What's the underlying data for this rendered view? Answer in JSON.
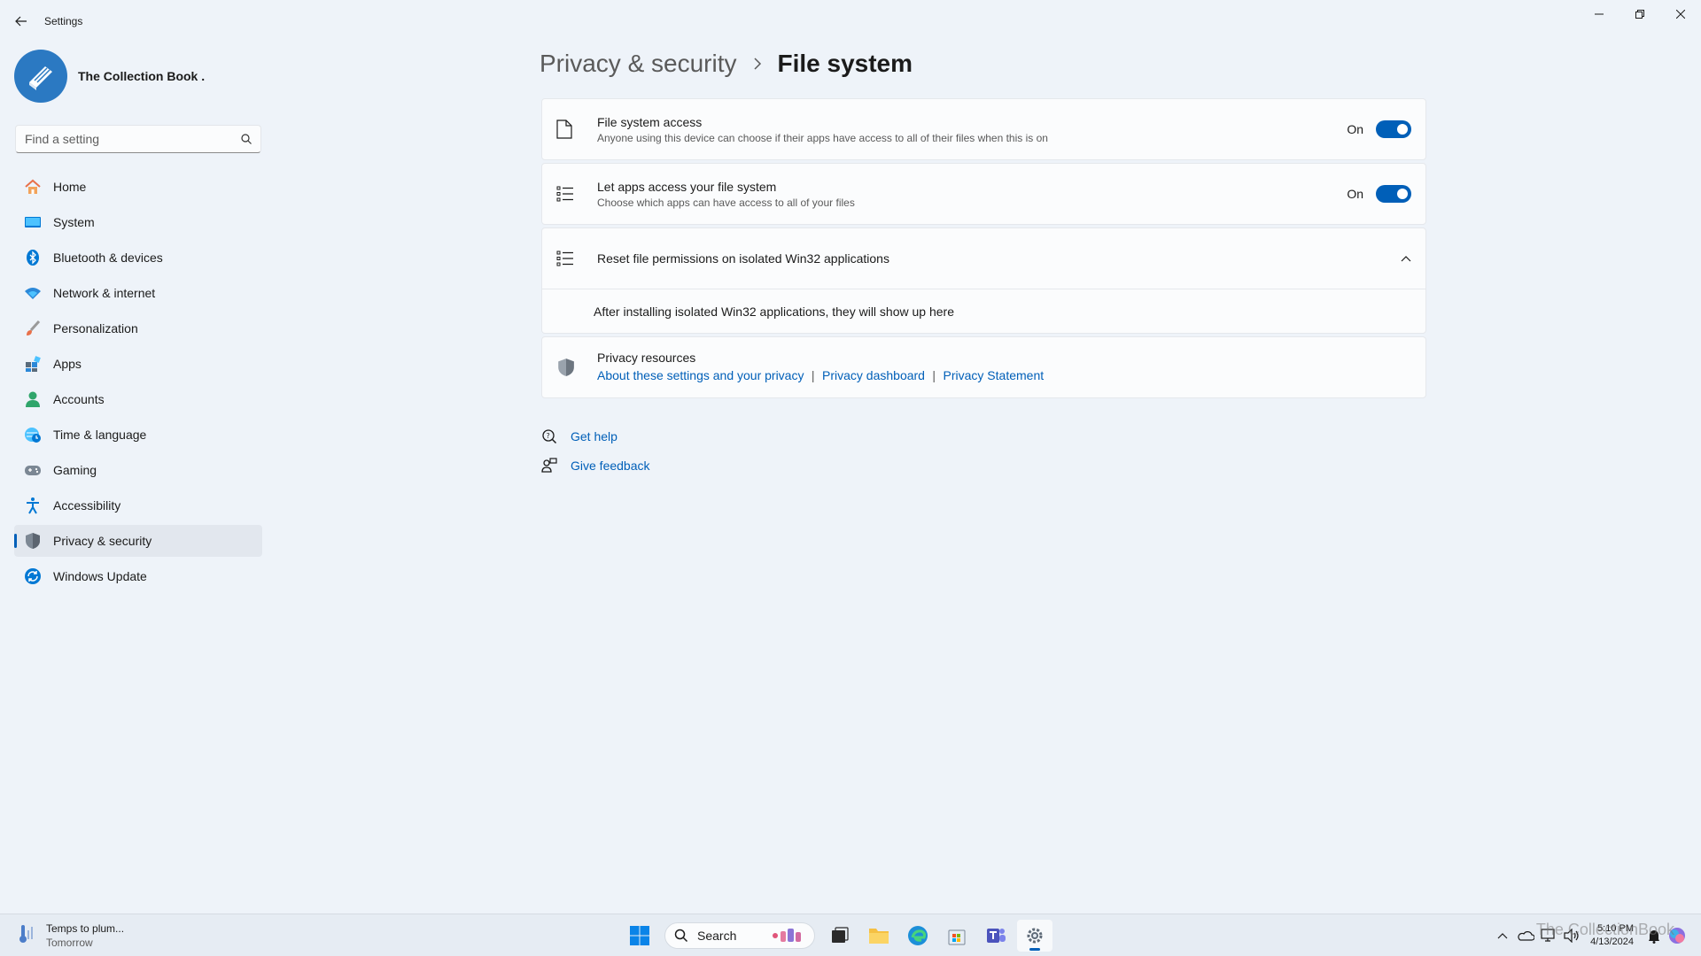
{
  "app": {
    "title": "Settings"
  },
  "profile": {
    "name": "The Collection Book ."
  },
  "search": {
    "placeholder": "Find a setting"
  },
  "sidebar": {
    "items": [
      {
        "label": "Home",
        "icon": "home-icon"
      },
      {
        "label": "System",
        "icon": "system-icon"
      },
      {
        "label": "Bluetooth & devices",
        "icon": "bluetooth-icon"
      },
      {
        "label": "Network & internet",
        "icon": "wifi-icon"
      },
      {
        "label": "Personalization",
        "icon": "brush-icon"
      },
      {
        "label": "Apps",
        "icon": "apps-icon"
      },
      {
        "label": "Accounts",
        "icon": "account-icon"
      },
      {
        "label": "Time & language",
        "icon": "globe-clock-icon"
      },
      {
        "label": "Gaming",
        "icon": "gamepad-icon"
      },
      {
        "label": "Accessibility",
        "icon": "accessibility-icon"
      },
      {
        "label": "Privacy & security",
        "icon": "shield-icon",
        "active": true
      },
      {
        "label": "Windows Update",
        "icon": "update-icon"
      }
    ]
  },
  "breadcrumb": {
    "parent": "Privacy & security",
    "current": "File system"
  },
  "settings": {
    "file_access": {
      "title": "File system access",
      "desc": "Anyone using this device can choose if their apps have access to all of their files when this is on",
      "state": "On"
    },
    "apps_access": {
      "title": "Let apps access your file system",
      "desc": "Choose which apps can have access to all of your files",
      "state": "On"
    },
    "reset": {
      "title": "Reset file permissions on isolated Win32 applications",
      "body": "After installing isolated Win32 applications, they will show up here"
    },
    "privacy_resources": {
      "title": "Privacy resources",
      "links": [
        "About these settings and your privacy",
        "Privacy dashboard",
        "Privacy Statement"
      ],
      "separator": "|"
    }
  },
  "help": {
    "get_help": "Get help",
    "give_feedback": "Give feedback"
  },
  "taskbar": {
    "weather_main": "Temps to plum...",
    "weather_sub": "Tomorrow",
    "search_label": "Search",
    "time": "5:10 PM",
    "date": "4/13/2024"
  },
  "watermark": "The CollectionBook",
  "colors": {
    "accent": "#005fb8",
    "background": "#eef3f9"
  }
}
